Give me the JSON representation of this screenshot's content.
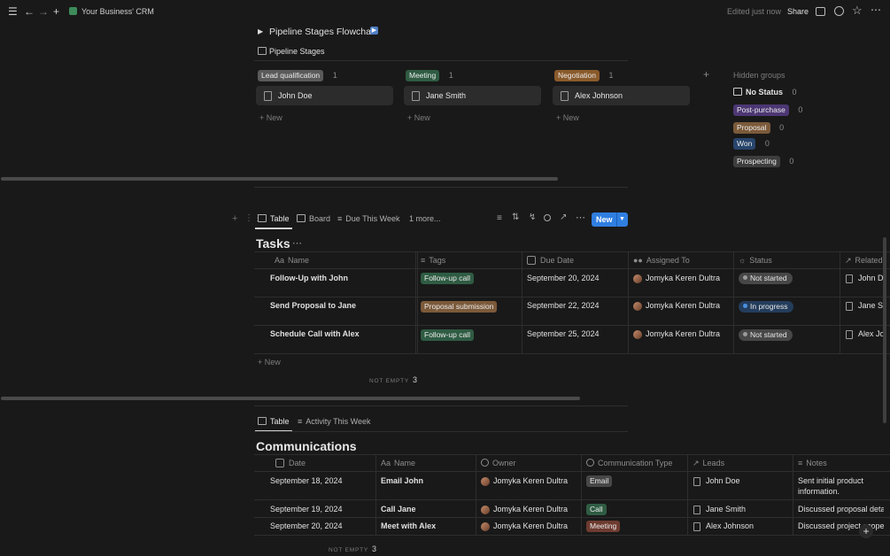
{
  "topbar": {
    "breadcrumb": "Your Business' CRM",
    "edited": "Edited just now",
    "share": "Share"
  },
  "pipeline": {
    "flowchart_toggle": "Pipeline Stages Flowchart",
    "view_title": "Pipeline Stages",
    "columns": [
      {
        "label": "Lead qualification",
        "count": "1",
        "card": "John Doe",
        "new": "New"
      },
      {
        "label": "Meeting",
        "count": "1",
        "card": "Jane Smith",
        "new": "New"
      },
      {
        "label": "Negotiation",
        "count": "1",
        "card": "Alex Johnson",
        "new": "New"
      }
    ],
    "hidden_groups_title": "Hidden groups",
    "hidden_groups": [
      {
        "label": "No Status",
        "count": "0"
      },
      {
        "label": "Post-purchase",
        "count": "0"
      },
      {
        "label": "Proposal",
        "count": "0"
      },
      {
        "label": "Won",
        "count": "0"
      },
      {
        "label": "Prospecting",
        "count": "0"
      }
    ]
  },
  "tasks": {
    "tabs": [
      "Table",
      "Board",
      "Due This Week",
      "1 more..."
    ],
    "new_button": "New",
    "title": "Tasks",
    "columns": [
      "Name",
      "Tags",
      "Due Date",
      "Assigned To",
      "Status",
      "Related"
    ],
    "name_prefix": "Aa",
    "rows": [
      {
        "name": "Follow-Up with John",
        "tag": "Follow-up call",
        "due": "September 20, 2024",
        "assigned": "Jomyka Keren Dultra",
        "status": "Not started",
        "related": "John D"
      },
      {
        "name": "Send Proposal to Jane",
        "tag": "Proposal submission",
        "due": "September 22, 2024",
        "assigned": "Jomyka Keren Dultra",
        "status": "In progress",
        "related": "Jane Sr"
      },
      {
        "name": "Schedule Call with Alex",
        "tag": "Follow-up call",
        "due": "September 25, 2024",
        "assigned": "Jomyka Keren Dultra",
        "status": "Not started",
        "related": "Alex Jo"
      }
    ],
    "new_row": "New",
    "footer_label": "NOT EMPTY",
    "footer_count": "3"
  },
  "communications": {
    "tabs": [
      "Table",
      "Activity This Week"
    ],
    "title": "Communications",
    "columns": [
      "Date",
      "Name",
      "Owner",
      "Communication Type",
      "Leads",
      "Notes"
    ],
    "name_prefix": "Aa",
    "rows": [
      {
        "date": "September 18, 2024",
        "name": "Email John",
        "owner": "Jomyka Keren Dultra",
        "type": "Email",
        "lead": "John Doe",
        "notes": "Sent initial product",
        "notes2": "information."
      },
      {
        "date": "September 19, 2024",
        "name": "Call Jane",
        "owner": "Jomyka Keren Dultra",
        "type": "Call",
        "lead": "Jane Smith",
        "notes": "Discussed proposal deta",
        "notes2": ""
      },
      {
        "date": "September 20, 2024",
        "name": "Meet with Alex",
        "owner": "Jomyka Keren Dultra",
        "type": "Meeting",
        "lead": "Alex Johnson",
        "notes": "Discussed project scope",
        "notes2": ""
      }
    ],
    "footer_label": "NOT EMPTY",
    "footer_count": "3"
  },
  "colors": {
    "background": "#191919",
    "accent_blue": "#2f7ee0"
  }
}
